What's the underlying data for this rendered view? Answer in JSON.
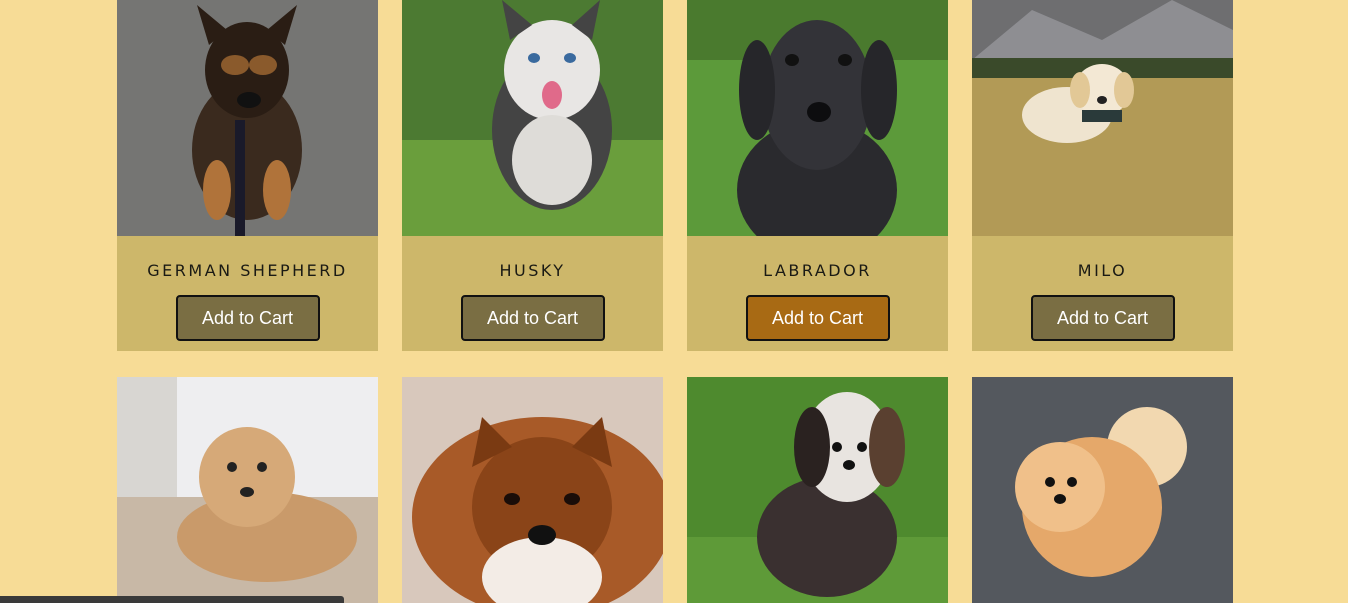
{
  "products": [
    {
      "name": "German Shepherd",
      "button": "Add to Cart",
      "photo_icon": "german-shepherd-puppy-photo"
    },
    {
      "name": "Husky",
      "button": "Add to Cart",
      "photo_icon": "husky-puppy-photo"
    },
    {
      "name": "Labrador",
      "button": "Add to Cart",
      "photo_icon": "labrador-puppy-photo",
      "hovered": true
    },
    {
      "name": "Milo",
      "button": "Add to Cart",
      "photo_icon": "golden-retriever-puppy-photo"
    }
  ],
  "gallery_row2": [
    {
      "photo_icon": "cavapoo-puppy-photo"
    },
    {
      "photo_icon": "sheltie-dog-photo"
    },
    {
      "photo_icon": "shih-tzu-dog-photo"
    },
    {
      "photo_icon": "pomeranian-dog-photo"
    }
  ],
  "colors": {
    "page_background": "#f7dc96",
    "card_background": "#cdb76a",
    "button": "#7a6e43",
    "button_hover": "#a86a14"
  }
}
